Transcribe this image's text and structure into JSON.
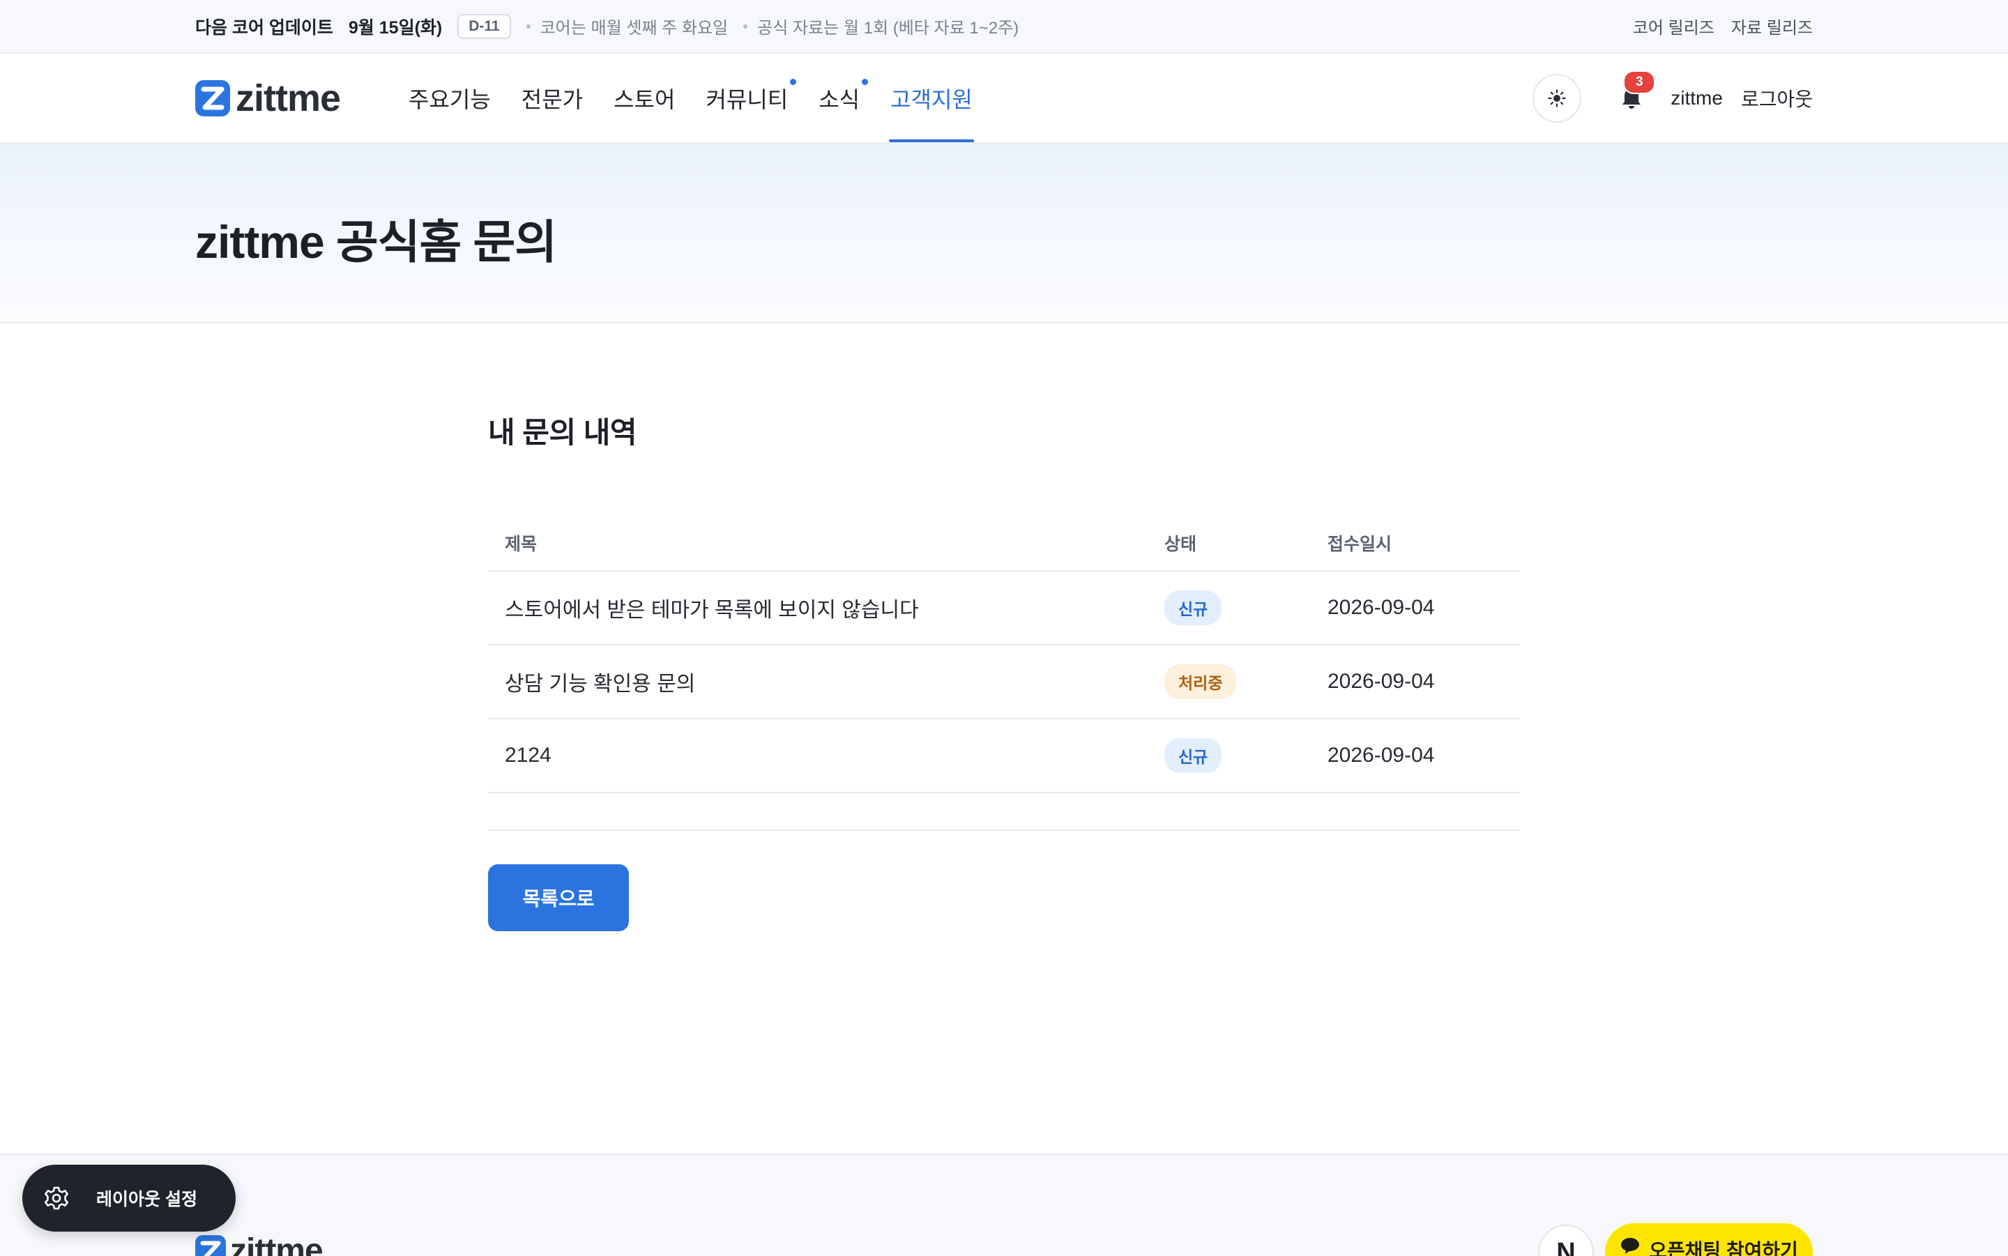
{
  "topbar": {
    "announce_label": "다음 코어 업데이트",
    "announce_date": "9월 15일(화)",
    "dday": "D-11",
    "note_1": "코어는 매월 셋째 주 화요일",
    "note_2": "공식 자료는 월 1회 (베타 자료 1~2주)",
    "links": [
      "코어 릴리즈",
      "자료 릴리즈"
    ]
  },
  "header": {
    "logo_text": "zittme",
    "nav": [
      {
        "label": "주요기능"
      },
      {
        "label": "전문가"
      },
      {
        "label": "스토어"
      },
      {
        "label": "커뮤니티"
      },
      {
        "label": "소식"
      },
      {
        "label": "고객지원"
      }
    ],
    "notification_count": "3",
    "username": "zittme",
    "logout_label": "로그아웃"
  },
  "page": {
    "title": "zittme 공식홈 문의"
  },
  "inquiries": {
    "section_title": "내 문의 내역",
    "columns": [
      "제목",
      "상태",
      "접수일시"
    ],
    "rows": [
      {
        "title": "스토어에서 받은 테마가 목록에 보이지 않습니다",
        "status": "신규",
        "date": "2026-09-04"
      },
      {
        "title": "상담 기능 확인용 문의",
        "status": "처리중",
        "date": "2026-09-04"
      },
      {
        "title": "2124",
        "status": "신규",
        "date": "2026-09-04"
      }
    ],
    "back_label": "목록으로"
  },
  "footer": {
    "logo_text": "zittme",
    "naver_label": "N",
    "openchat_label": "오픈채팅 참여하기"
  },
  "layout_setting": {
    "label": "레이아웃 설정"
  },
  "colors": {
    "accent": "#2b6fdb",
    "status_new_bg": "#e3eefc",
    "status_progress_bg": "#fdf0dc",
    "notification_badge": "#e5413d",
    "kakao_yellow": "#fee500"
  },
  "icons": [
    "logo-mark-icon",
    "sun-icon",
    "bell-icon",
    "gear-icon",
    "chat-bubble-icon"
  ]
}
